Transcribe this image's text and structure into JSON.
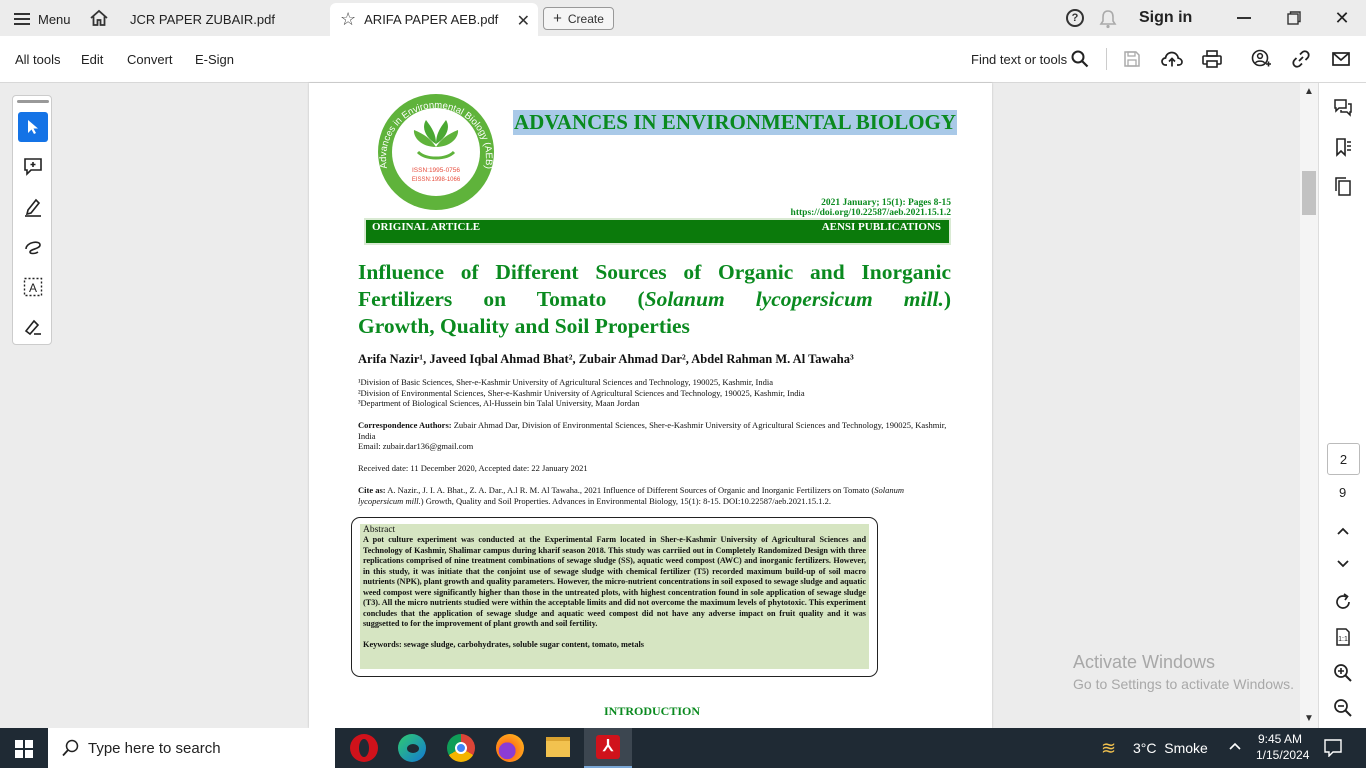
{
  "tabbar": {
    "menu_label": "Menu",
    "tabs": [
      {
        "label": "JCR PAPER ZUBAIR.pdf"
      },
      {
        "label": "ARIFA PAPER AEB.pdf"
      }
    ],
    "create_label": "Create",
    "sign_in_label": "Sign in"
  },
  "toolbar": {
    "items": [
      "All tools",
      "Edit",
      "Convert",
      "E-Sign"
    ],
    "find_label": "Find text or tools"
  },
  "document": {
    "logo_ring_text": "Advances in Environmental Biology (AEB)",
    "logo_issn": "ISSN:1995-0756",
    "logo_eissn": "EISSN:1998-1066",
    "journal_title": "ADVANCES IN ENVIRONMENTAL BIOLOGY",
    "issue_line": "2021 January; 15(1): Pages 8-15",
    "doi_line": "https://doi.org/10.22587/aeb.2021.15.1.2",
    "banner_left": "ORIGINAL ARTICLE",
    "banner_right": "AENSI PUBLICATIONS",
    "title_line1": "Influence of Different Sources of Organic and Inorganic",
    "title_line2_a": "Fertilizers on Tomato (",
    "title_line2_b": "Solanum lycopersicum mill.",
    "title_line2_c": ")",
    "title_line3": "Growth, Quality and Soil Properties",
    "authors": "Arifa Nazir¹, Javeed Iqbal Ahmad Bhat², Zubair Ahmad Dar², Abdel Rahman M. Al Tawaha³",
    "affil1": "¹Division of Basic Sciences, Sher-e-Kashmir University of Agricultural Sciences and Technology, 190025, Kashmir, India",
    "affil2": "²Division of Environmental Sciences, Sher-e-Kashmir University of Agricultural Sciences and Technology, 190025, Kashmir, India",
    "affil3": "³Department of Biological Sciences, Al-Hussein bin Talal University, Maan Jordan",
    "corr_label": "Correspondence Authors:",
    "corr_text": " Zubair Ahmad Dar, Division of Environmental Sciences, Sher-e-Kashmir University of Agricultural Sciences and Technology, 190025, Kashmir, India",
    "email_line": "Email: zubair.dar136@gmail.com",
    "dates_line": "Received date: 11 December 2020,  Accepted date: 22 January 2021",
    "cite_label": "Cite as:",
    "cite_text_a": " A. Nazir., J. I. A. Bhat., Z. A. Dar., A.l R. M. Al Tawaha., 2021 Influence of Different Sources of Organic and Inorganic Fertilizers on Tomato (",
    "cite_text_b": "Solanum lycopersicum mill.",
    "cite_text_c": ") Growth, Quality and Soil Properties. Advances in Environmental Biology, 15(1): 8-15. DOI:10.22587/aeb.2021.15.1.2.",
    "abstract_heading": "Abstract",
    "abstract_body": "A pot culture experiment was conducted at the Experimental Farm located in Sher-e-Kashmir University of Agricultural Sciences and Technology of Kashmir, Shalimar campus during kharif season 2018.  This study was carriied out in Completely Randomized Design with three replications comprised of nine treatment combinations of sewage sludge (SS),  aquatic weed compost (AWC) and inorganic fertilizers. However, in this study, it was initiate that the conjoint use of sewage sludge with chemical fertilizer (T5) recorded maximum build-up of soil macro nutrients (NPK), plant growth and quality parameters. However, the micro-nutrient concentrations in soil exposed to sewage sludge and aquatic weed compost were significantly higher than those in the untreated plots, with highest concentration found in sole application of sewage sludge (T3). All the micro nutrients studied were within the acceptable limits and did not overcome the maximum levels of phytotoxic. This experiment concludes that the application of sewage sludge and aquatic weed compost did not have any adverse impact on fruit quality and it was suggsetted to for the improvement of plant growth and soil fertility.",
    "keywords_line": "Keywords: sewage sludge, carbohydrates, soluble sugar content, tomato, metals",
    "intro_heading": "INTRODUCTION"
  },
  "right_rail": {
    "current_page": "2",
    "total_pages": "9"
  },
  "watermark": {
    "line1": "Activate Windows",
    "line2": "Go to Settings to activate Windows."
  },
  "taskbar": {
    "search_placeholder": "Type here to search",
    "weather": "3°C  Smoke",
    "time": "9:45 AM",
    "date": "1/15/2024"
  },
  "colors": {
    "journal_green": "#0a8a1f",
    "banner_green": "#0b7a0b",
    "abstract_bg": "#d6e5c2",
    "highlight": "#a9c9e8",
    "accent_blue": "#1473e6"
  }
}
